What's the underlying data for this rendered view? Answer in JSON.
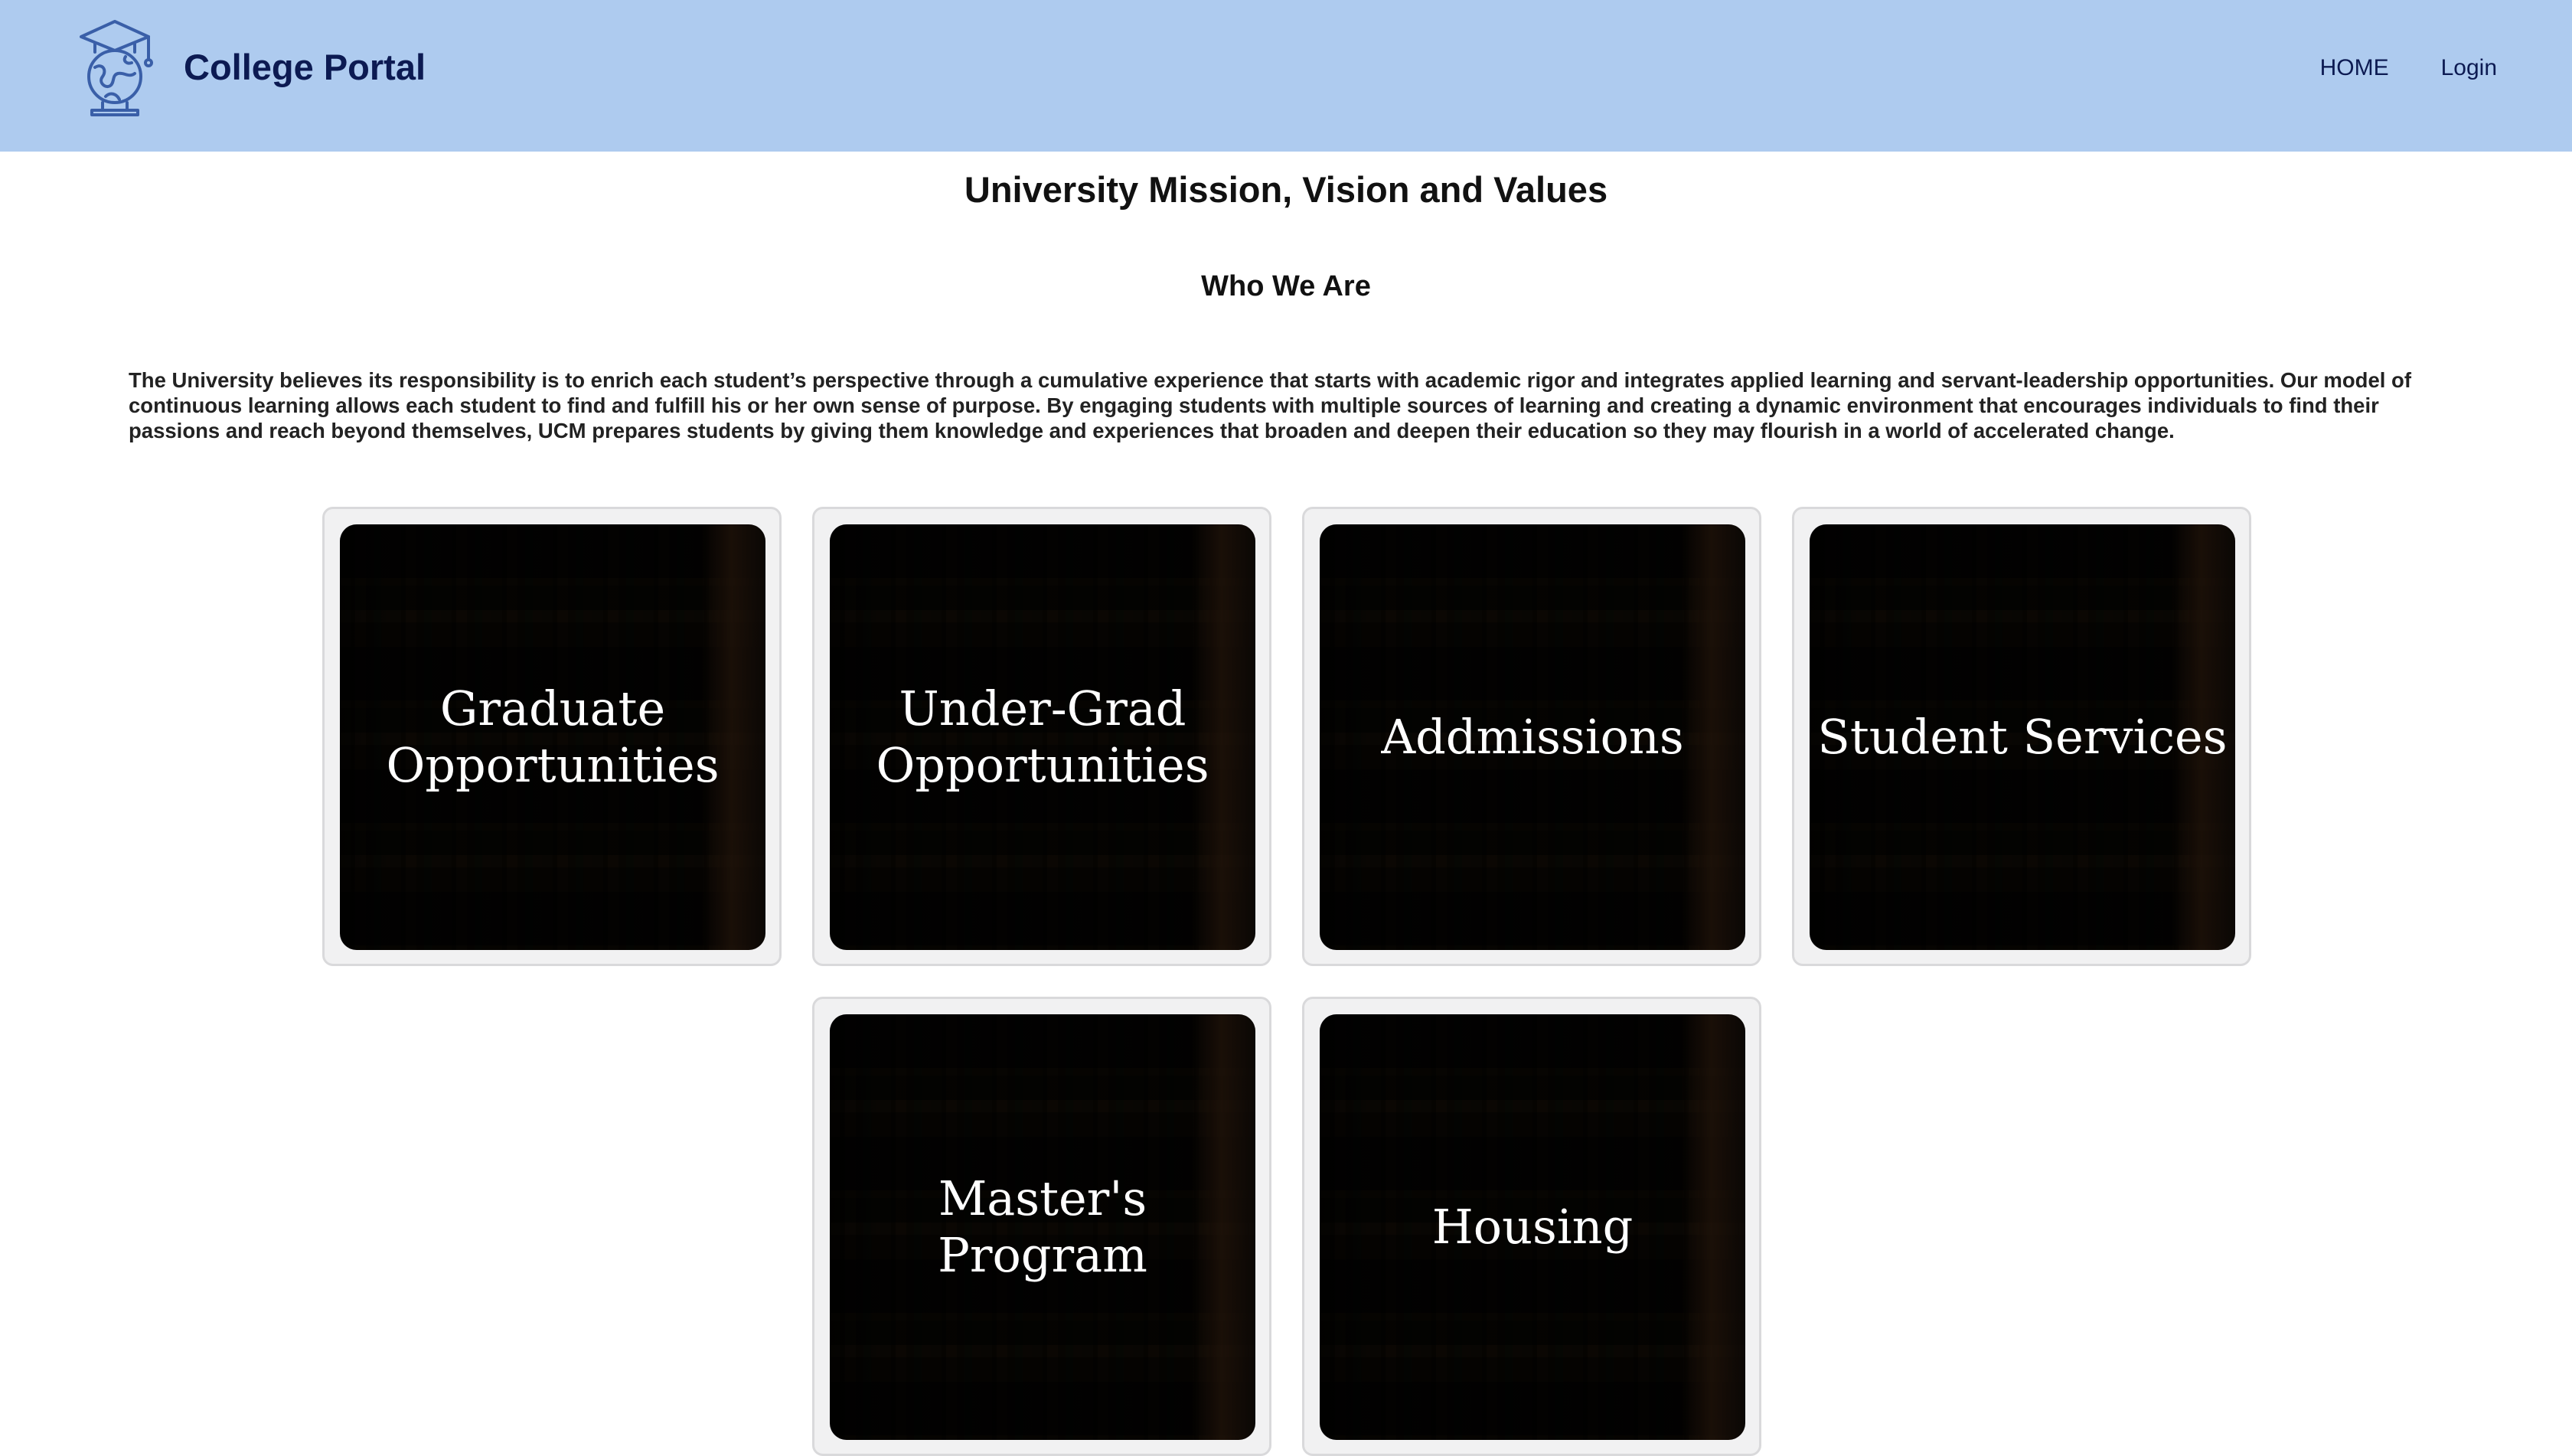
{
  "app": {
    "brand_name": "College Portal",
    "logo_icon": "graduation-globe-icon",
    "colors": {
      "navbar_bg": "#aecbef",
      "brand_text": "#0c1a52"
    }
  },
  "nav": {
    "items": [
      {
        "label": "HOME"
      },
      {
        "label": "Login"
      }
    ]
  },
  "main": {
    "title": "University Mission, Vision and Values",
    "subtitle": "Who We Are",
    "mission_text": "The University believes its responsibility is to enrich each student’s perspective through a cumulative experience that starts with academic rigor and integrates applied learning and servant-leadership opportunities. Our model of continuous learning allows each student to find and fulfill his or her own sense of purpose. By engaging students with multiple sources of learning and creating a dynamic environment that encourages individuals to find their passions and reach beyond themselves, UCM prepares students by giving them knowledge and experiences that broaden and deepen their education so they may flourish in a world of accelerated change."
  },
  "cards": [
    {
      "label": "Graduate Opportunities"
    },
    {
      "label": "Under-Grad Opportunities"
    },
    {
      "label": "Addmissions"
    },
    {
      "label": "Student Services"
    },
    {
      "label": "Master's Program"
    },
    {
      "label": "Housing"
    }
  ]
}
